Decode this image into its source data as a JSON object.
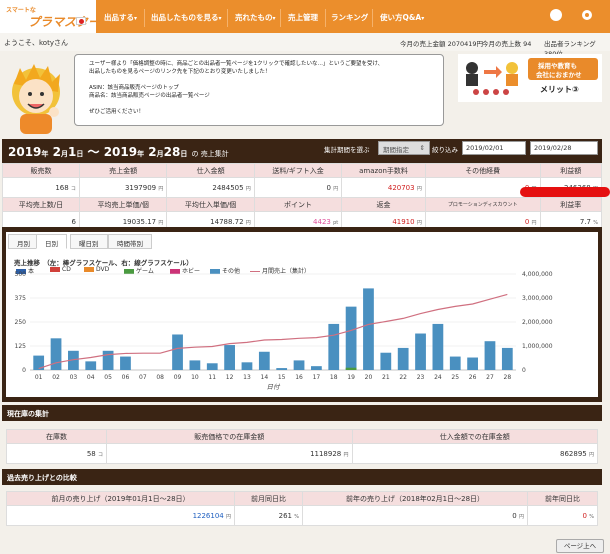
{
  "header": {
    "logo_small": "スマートな",
    "logo_big": "プラマスター",
    "nav": [
      "出品する",
      "出品したものを見る",
      "売れたもの",
      "売上管理",
      "ランキング",
      "使い方Q&A"
    ],
    "nav_caret": "▾"
  },
  "statusbar": {
    "welcome": "ようこそ、kotyさん",
    "today_amount": "今月の売上金額 2070419円",
    "today_count": "今月の売上数 94",
    "rank": "出品者ランキング 380位"
  },
  "notice": {
    "lines": [
      "ユーザー様より「価格調整の時に、商品ごとの出品者一覧ページを1クリックで確認したいな…」というご要望を受け、",
      "出品したものを見るページのリンク先を下記のとおり変更いたしました！",
      "",
      "ASIN：該当商品販売ページのトップ",
      "商品名：該当商品販売ページの出品者一覧ページ",
      "",
      "ぜひご活用ください！"
    ]
  },
  "promo": {
    "text1": "採用や教育も",
    "text2": "会社におまかせ",
    "text3": "メリット③"
  },
  "summary": {
    "title_year1": "2019",
    "title_m1": "2",
    "title_d1": "1",
    "title_year2": "2019",
    "title_m2": "2",
    "title_d2": "28",
    "title_suffix": "の 売上集計",
    "u_year": "年",
    "u_month": "月",
    "u_day": "日",
    "tilde": "〜",
    "period_label": "集計期間を選ぶ",
    "period_value": "期間指定",
    "filter_btn": "絞り込み",
    "date_from": "2019/02/01",
    "date_to": "2019/02/28",
    "row1_labels": [
      "販売数",
      "売上金額",
      "仕入金額",
      "送料/ギフト入金",
      "amazon手数料",
      "その他経費",
      "利益額"
    ],
    "row1_values": [
      "168",
      "3197909",
      "2484505",
      "0",
      "420703",
      "0",
      "246368"
    ],
    "row1_units": [
      "コ",
      "円",
      "円",
      "円",
      "円",
      "円",
      "円"
    ],
    "row2_labels": [
      "平均売上数/日",
      "平均売上単価/個",
      "平均仕入単価/個",
      "ポイント",
      "返金",
      "プロモーションディスカウント",
      "利益率"
    ],
    "row2_values": [
      "6",
      "19035.17",
      "14788.72",
      "4423",
      "41910",
      "0",
      "7.7"
    ],
    "row2_units": [
      "",
      "円",
      "円",
      "pt",
      "円",
      "円",
      "%"
    ]
  },
  "tabs": [
    "月別",
    "日別",
    "曜日別",
    "時間帯別"
  ],
  "chart_data": {
    "type": "bar",
    "title": "売上推移　（左：棒グラフスケール、右：線グラフスケール）",
    "legend": [
      "本",
      "CD",
      "DVD",
      "ゲーム",
      "ホビー",
      "その他",
      "月間売上（集計）"
    ],
    "legend_colors": [
      "#2c5fa8",
      "#d0403a",
      "#e98a2a",
      "#4a9a40",
      "#cc3377",
      "#4a90c0",
      "#d07080"
    ],
    "xlabel": "日付",
    "categories": [
      "01",
      "02",
      "03",
      "04",
      "05",
      "06",
      "07",
      "08",
      "09",
      "10",
      "11",
      "12",
      "13",
      "14",
      "15",
      "16",
      "17",
      "18",
      "19",
      "20",
      "21",
      "22",
      "23",
      "24",
      "25",
      "26",
      "27",
      "28"
    ],
    "series": [
      {
        "name": "その他",
        "values": [
          75,
          165,
          100,
          45,
          100,
          70,
          0,
          0,
          185,
          50,
          35,
          130,
          40,
          95,
          10,
          50,
          20,
          240,
          330,
          425,
          90,
          115,
          190,
          240,
          70,
          65,
          150,
          115
        ]
      },
      {
        "name": "ゲーム",
        "values": [
          0,
          0,
          0,
          0,
          0,
          0,
          0,
          0,
          0,
          0,
          0,
          0,
          0,
          0,
          0,
          0,
          0,
          0,
          12,
          0,
          0,
          0,
          0,
          0,
          0,
          0,
          0,
          0
        ]
      }
    ],
    "line": {
      "name": "月間売上（集計）",
      "values": [
        60000,
        300000,
        430000,
        520000,
        640000,
        690000,
        700000,
        700000,
        900000,
        950000,
        980000,
        1100000,
        1150000,
        1250000,
        1270000,
        1320000,
        1350000,
        1450000,
        1650000,
        1900000,
        2020000,
        2150000,
        2350000,
        2520000,
        2650000,
        2750000,
        2950000,
        3150000
      ]
    },
    "ylim_left": [
      0,
      500
    ],
    "ylim_right": [
      0,
      4000000
    ],
    "yticks_left": [
      "500",
      "375",
      "250",
      "125",
      "0"
    ],
    "yticks_right": [
      "4,000,000",
      "3,000,000",
      "2,000,000",
      "1,000,000",
      "0"
    ]
  },
  "stock": {
    "title": "現在庫の集計",
    "labels": [
      "在庫数",
      "販売価格での在庫金額",
      "仕入金額での在庫金額"
    ],
    "values": [
      "58",
      "1118928",
      "862895"
    ],
    "units": [
      "コ",
      "円",
      "円"
    ]
  },
  "compare": {
    "title": "過去売り上げとの比較",
    "labels": [
      "前月の売り上げ（2019年01月1日〜28日）",
      "前月同日比",
      "前年の売り上げ（2018年02月1日〜28日）",
      "前年同日比"
    ],
    "values": [
      "1226104",
      "261",
      "0",
      "0"
    ],
    "units": [
      "円",
      "%",
      "円",
      "%"
    ]
  },
  "pagetop": "ページ上へ"
}
